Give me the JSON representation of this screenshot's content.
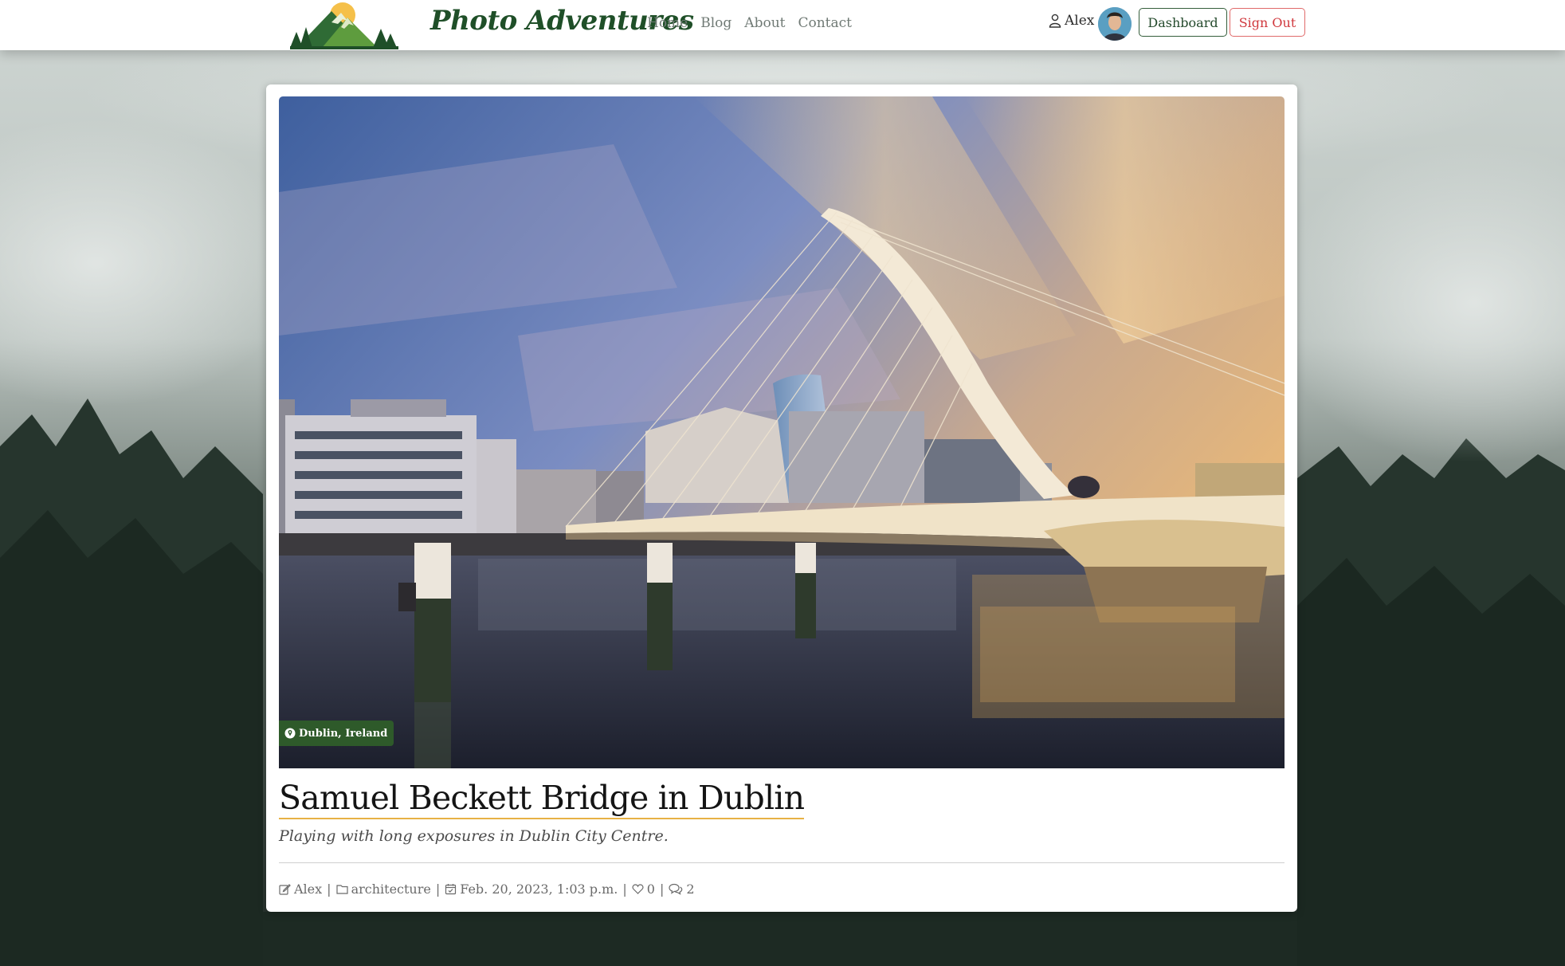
{
  "navbar": {
    "brand": "Photo Adventures",
    "links": [
      "Home",
      "Blog",
      "About",
      "Contact"
    ],
    "user_name": "Alex",
    "dashboard_label": "Dashboard",
    "signout_label": "Sign Out"
  },
  "post": {
    "location": "Dublin, Ireland",
    "title": "Samuel Beckett Bridge in Dublin",
    "subtitle": "Playing with long exposures in Dublin City Centre.",
    "author": "Alex",
    "category": "architecture",
    "date": "Feb. 20, 2023, 1:03 p.m.",
    "likes": "0",
    "comments": "2"
  },
  "icons": {
    "logo": "mountain-sun-logo",
    "user": "user-icon",
    "location": "location-pin-icon",
    "author": "pencil-square-icon",
    "category": "folder-icon",
    "date": "calendar-check-icon",
    "likes": "heart-icon",
    "comments": "comments-icon"
  },
  "colors": {
    "brand_green": "#1f4f28",
    "badge_green": "#2e5a2a",
    "signout_red": "#d0383d",
    "title_underline": "#e7b245"
  }
}
